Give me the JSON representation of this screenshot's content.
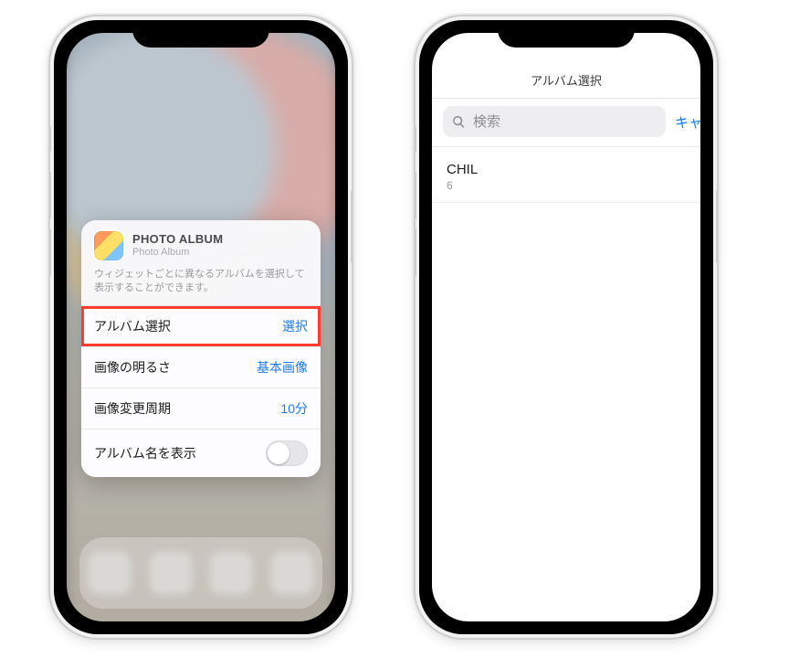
{
  "left": {
    "app_title": "PHOTO ALBUM",
    "app_subtitle": "Photo Album",
    "description": "ウィジェットごとに異なるアルバムを選択して表示することができます。",
    "rows": {
      "album_select": {
        "label": "アルバム選択",
        "value": "選択"
      },
      "brightness": {
        "label": "画像の明るさ",
        "value": "基本画像"
      },
      "interval": {
        "label": "画像変更周期",
        "value": "10分"
      },
      "show_name": {
        "label": "アルバム名を表示"
      }
    }
  },
  "right": {
    "nav_title": "アルバム選択",
    "search_placeholder": "検索",
    "cancel_label": "キャンセル",
    "albums": [
      {
        "name": "CHIL",
        "count": "6"
      }
    ]
  }
}
